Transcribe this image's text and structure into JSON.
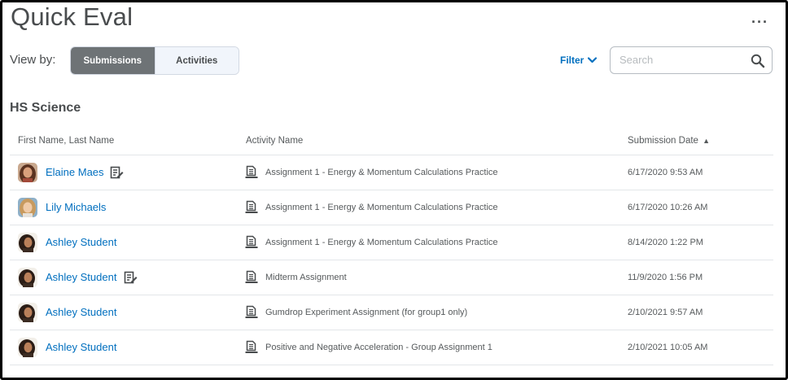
{
  "header": {
    "title": "Quick Eval",
    "more_label": "···"
  },
  "toolbar": {
    "view_by_label": "View by:",
    "tabs": [
      {
        "label": "Submissions",
        "active": true
      },
      {
        "label": "Activities",
        "active": false
      }
    ],
    "filter_label": "Filter",
    "search_placeholder": "Search"
  },
  "section": {
    "title": "HS Science"
  },
  "table": {
    "columns": {
      "name": "First Name, Last Name",
      "activity": "Activity Name",
      "date": "Submission Date"
    },
    "sort_indicator": "▲",
    "rows": [
      {
        "name": "Elaine Maes",
        "has_note": true,
        "avatar": "avatar-elaine",
        "activity": "Assignment 1 - Energy & Momentum Calculations Practice",
        "date": "6/17/2020 9:53 AM"
      },
      {
        "name": "Lily Michaels",
        "has_note": false,
        "avatar": "avatar-lily",
        "activity": "Assignment 1 - Energy & Momentum Calculations Practice",
        "date": "6/17/2020 10:26 AM"
      },
      {
        "name": "Ashley Student",
        "has_note": false,
        "avatar": "avatar-ashley",
        "activity": "Assignment 1 - Energy & Momentum Calculations Practice",
        "date": "8/14/2020 1:22 PM"
      },
      {
        "name": "Ashley Student",
        "has_note": true,
        "avatar": "avatar-ashley",
        "activity": "Midterm Assignment",
        "date": "11/9/2020 1:56 PM"
      },
      {
        "name": "Ashley Student",
        "has_note": false,
        "avatar": "avatar-ashley",
        "activity": "Gumdrop Experiment Assignment (for group1 only)",
        "date": "2/10/2021 9:57 AM"
      },
      {
        "name": "Ashley Student",
        "has_note": false,
        "avatar": "avatar-ashley",
        "activity": "Positive and Negative Acceleration - Group Assignment 1",
        "date": "2/10/2021 10:05 AM"
      }
    ]
  },
  "colors": {
    "link": "#006fbf",
    "text": "#494c4e",
    "active_tab": "#6e7376"
  }
}
